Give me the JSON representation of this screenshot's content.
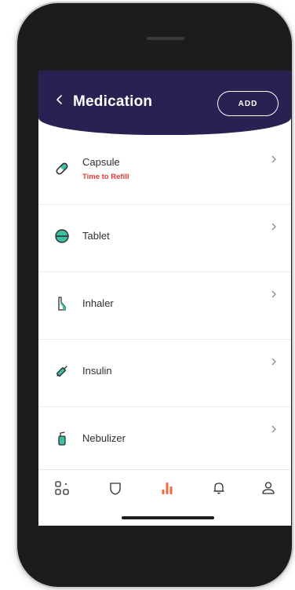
{
  "header": {
    "title": "Medication",
    "add_label": "ADD"
  },
  "medications": [
    {
      "name": "Capsule",
      "status": "Time to Refill",
      "icon": "capsule-icon"
    },
    {
      "name": "Tablet",
      "status": "",
      "icon": "tablet-icon"
    },
    {
      "name": "Inhaler",
      "status": "",
      "icon": "inhaler-icon"
    },
    {
      "name": "Insulin",
      "status": "",
      "icon": "insulin-pen-icon"
    },
    {
      "name": "Nebulizer",
      "status": "",
      "icon": "nebulizer-icon"
    }
  ],
  "tabs": [
    {
      "icon": "dashboard-icon",
      "active": false
    },
    {
      "icon": "shield-icon",
      "active": false
    },
    {
      "icon": "stats-icon",
      "active": true
    },
    {
      "icon": "bell-icon",
      "active": false
    },
    {
      "icon": "profile-icon",
      "active": false
    }
  ],
  "colors": {
    "header_bg": "#2b2052",
    "accent": "#f26a3a",
    "icon_teal": "#3dbfa4",
    "status_red": "#e43b3b"
  }
}
